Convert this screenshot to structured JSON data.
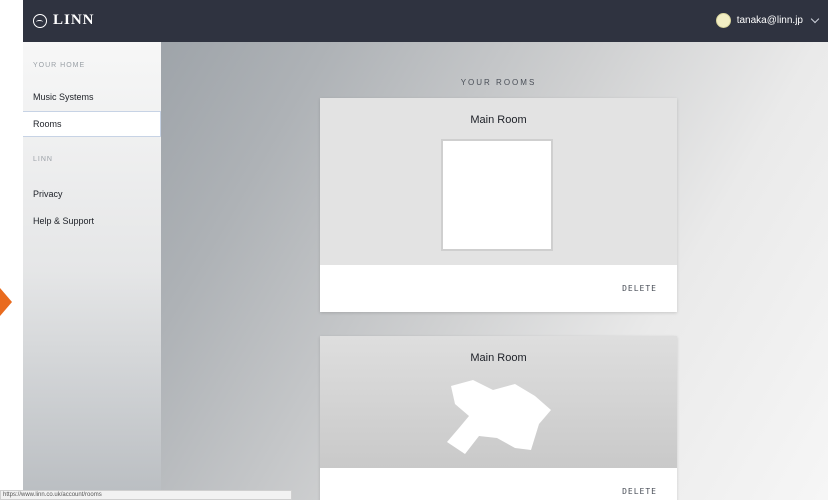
{
  "brand": {
    "name": "LINN",
    "icon": "linn-logo-icon"
  },
  "user": {
    "email": "tanaka@linn.jp",
    "menu_icon": "chevron-down-icon"
  },
  "sidebar": {
    "sections": [
      {
        "title": "YOUR HOME",
        "items": [
          {
            "label": "Music Systems"
          },
          {
            "label": "Rooms",
            "active": true
          }
        ]
      },
      {
        "title": "LINN",
        "items": [
          {
            "label": "Privacy"
          },
          {
            "label": "Help & Support"
          }
        ]
      }
    ]
  },
  "main": {
    "heading": "YOUR ROOMS",
    "rooms": [
      {
        "name": "Main Room",
        "action": "DELETE",
        "image": "blank"
      },
      {
        "name": "Main Room",
        "action": "DELETE",
        "image": "room-shape"
      }
    ]
  },
  "status_bar": {
    "url": "https://www.linn.co.uk/account/rooms"
  },
  "colors": {
    "topbar": "#2f3340",
    "accent_arrow": "#e96b1e",
    "active_border": "#c7d3e5"
  }
}
